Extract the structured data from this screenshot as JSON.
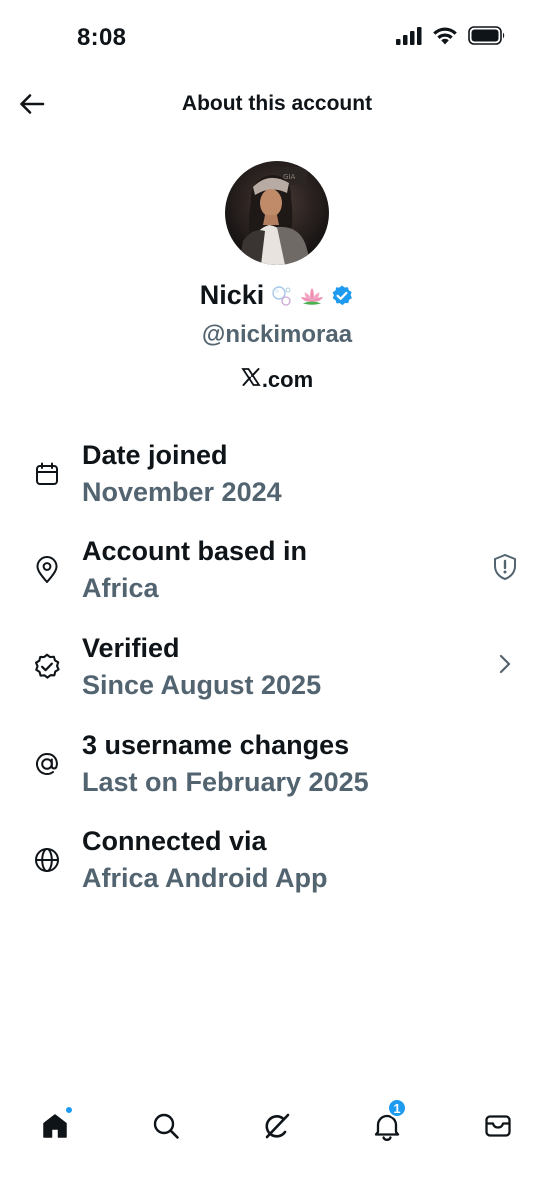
{
  "status_bar": {
    "time": "8:08"
  },
  "header": {
    "title": "About this account"
  },
  "profile": {
    "name": "Nicki",
    "emojis": [
      "bubbles-emoji",
      "lotus-emoji"
    ],
    "handle": "@nickimoraa",
    "connected_site": ".com",
    "verified_color": "#1d9bf0"
  },
  "info_items": [
    {
      "title": "Date joined",
      "subtitle": "November 2024",
      "icon": "calendar-icon"
    },
    {
      "title": "Account based in",
      "subtitle": "Africa",
      "icon": "location-pin-icon",
      "trailing_icon": "shield-alert-icon"
    },
    {
      "title": "Verified",
      "subtitle": "Since August 2025",
      "icon": "verified-badge-outline-icon",
      "trailing_icon": "chevron-right-icon"
    },
    {
      "title": "3 username changes",
      "subtitle": "Last on February 2025",
      "icon": "at-sign-icon"
    },
    {
      "title": "Connected via",
      "subtitle": "Africa Android App",
      "icon": "globe-icon"
    }
  ],
  "bottom_nav": {
    "items": [
      "home-icon",
      "search-icon",
      "grok-icon",
      "notifications-icon",
      "messages-icon"
    ],
    "notification_count": "1"
  },
  "colors": {
    "primary_text": "#0f1419",
    "secondary_text": "#536471",
    "accent": "#1d9bf0"
  }
}
